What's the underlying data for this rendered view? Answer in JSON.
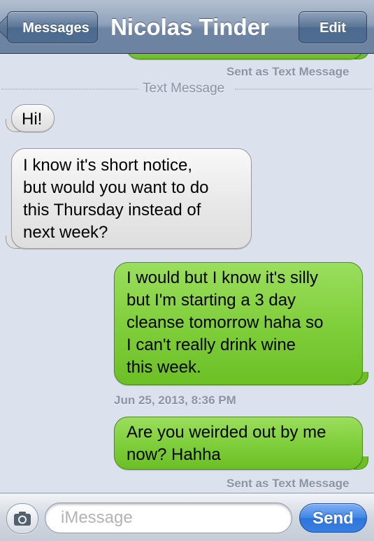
{
  "nav": {
    "back_label": "Messages",
    "title": "Nicolas Tinder",
    "edit_label": "Edit"
  },
  "conversation": {
    "top_status": "Sent as Text Message",
    "divider_label": "Text Message",
    "messages": [
      {
        "direction": "incoming",
        "text": "Hi!"
      },
      {
        "direction": "incoming",
        "text": "I know it's short notice,\nbut would you want to do\nthis Thursday instead of\nnext week?"
      },
      {
        "direction": "outgoing",
        "text": "I would but I know it's silly\nbut I'm starting a 3 day\ncleanse tomorrow haha so\nI can't really drink wine\nthis week."
      },
      {
        "direction": "outgoing",
        "text": "Are you weirded out by me\nnow? Hahha"
      }
    ],
    "timestamp": "Jun 25, 2013, 8:36 PM",
    "bottom_status": "Sent as Text Message"
  },
  "input": {
    "camera_icon": "camera-icon",
    "placeholder": "iMessage",
    "send_label": "Send"
  },
  "colors": {
    "nav_bar": "#6d84a2",
    "background": "#dbe2ed",
    "incoming_bubble": "#e8e8e8",
    "outgoing_bubble": "#80cf3c",
    "send_button": "#3f86e6"
  }
}
